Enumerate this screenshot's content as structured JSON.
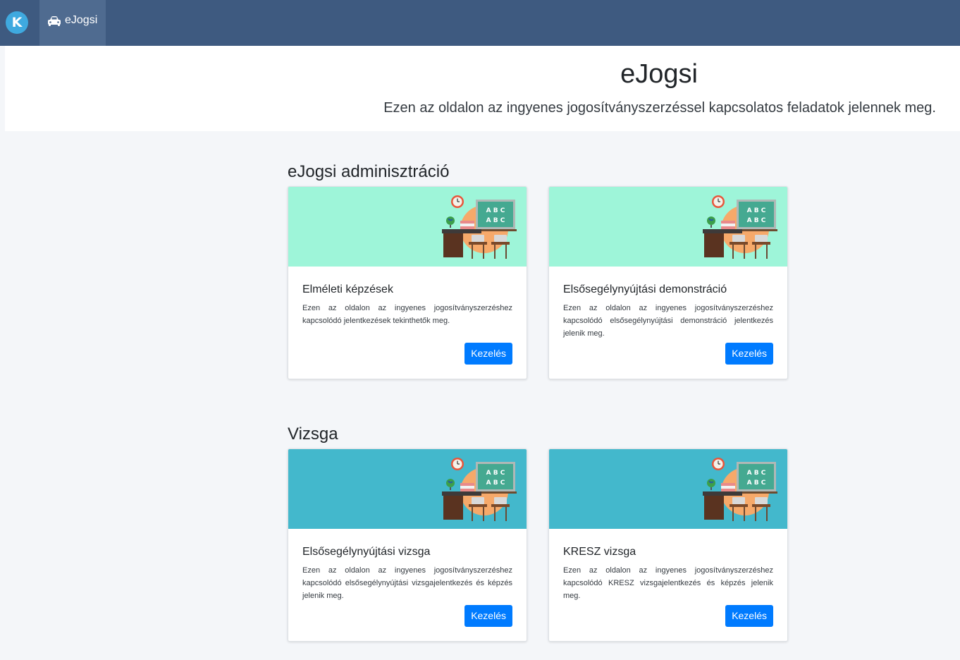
{
  "nav": {
    "logo_letter": "K",
    "item_label": "eJogsi"
  },
  "hero": {
    "title": "eJogsi",
    "subtitle": "Ezen az oldalon az ingyenes jogosítványszerzéssel kapcsolatos feladatok jelennek meg."
  },
  "illustration": {
    "board_text": "A B C",
    "board_text_2": "A B C"
  },
  "sections": [
    {
      "title": "eJogsi adminisztráció",
      "banner_color": "#9ef5d9",
      "cards": [
        {
          "title": "Elméleti képzések",
          "text": "Ezen az oldalon az ingyenes jogosítványszerzéshez kapcsolódó jelentkezések tekinthetők meg.",
          "button": "Kezelés"
        },
        {
          "title": "Elsősegélynyújtási demonstráció",
          "text": "Ezen az oldalon az ingyenes jogosítványszerzéshez kapcsolódó elsősegélynyújtási demonstráció jelentkezés jelenik meg.",
          "button": "Kezelés"
        }
      ]
    },
    {
      "title": "Vizsga",
      "banner_color": "#43b8cc",
      "cards": [
        {
          "title": "Elsősegélynyújtási vizsga",
          "text": "Ezen az oldalon az ingyenes jogosítványszerzéshez kapcsolódó elsősegélynyújtási vizsgajelentkezés és képzés jelenik meg.",
          "button": "Kezelés"
        },
        {
          "title": "KRESZ vizsga",
          "text": "Ezen az oldalon az ingyenes jogosítványszerzéshez kapcsolódó KRESZ vizsgajelentkezés és képzés jelenik meg.",
          "button": "Kezelés"
        }
      ]
    }
  ],
  "colors": {
    "navbar": "#3e5a80",
    "primary_button": "#007bff"
  }
}
